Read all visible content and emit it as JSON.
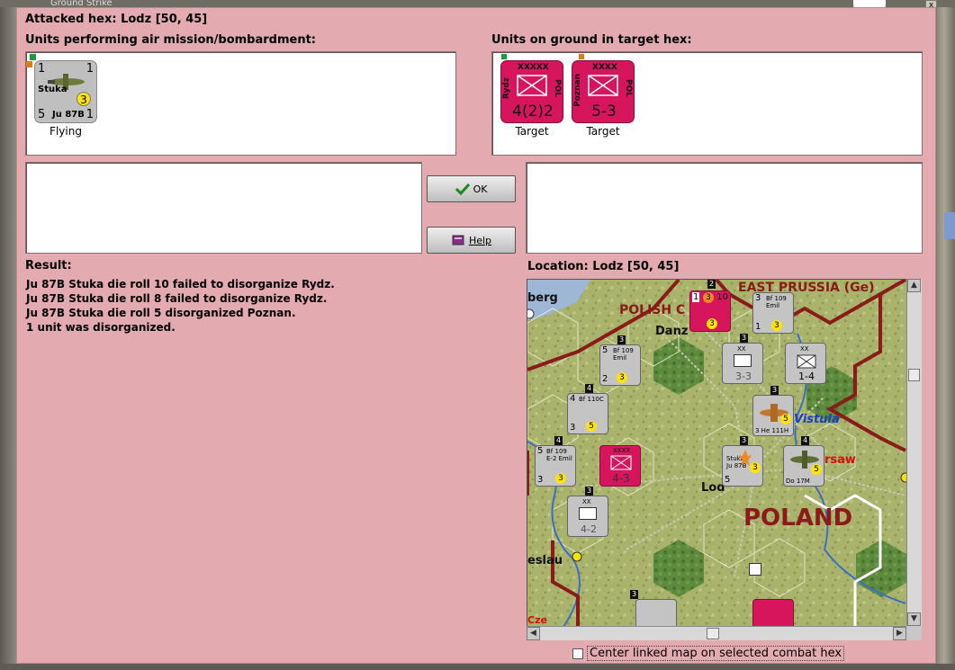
{
  "window": {
    "title": "Ground Strike",
    "close_glyph": "x"
  },
  "attacked_hex": "Attacked hex: Lodz  [50, 45]",
  "air_section": {
    "label": "Units performing air mission/bombardment:",
    "units": [
      {
        "name": "Stuka",
        "type": "Ju 87B",
        "top_left": "1",
        "top_right": "1",
        "bottom_left": "5",
        "bottom_right": "1",
        "badge": "3",
        "status": "Flying"
      }
    ]
  },
  "ground_section": {
    "label": "Units on ground in target hex:",
    "units": [
      {
        "name": "Rydz",
        "size": "XXXXX",
        "nation": "POL",
        "strength": "4(2)2",
        "status": "Target"
      },
      {
        "name": "Poznan",
        "size": "XXXX",
        "nation": "POL",
        "strength": "5-3",
        "status": "Target"
      }
    ]
  },
  "buttons": {
    "ok": "OK",
    "help": "Help"
  },
  "result": {
    "label": "Result:",
    "lines": [
      "Ju 87B Stuka die roll 10 failed to disorganize Rydz.",
      "Ju 87B Stuka die roll 8 failed to disorganize Rydz.",
      "Ju 87B Stuka die roll 5 disorganized Poznan.",
      "1 unit was disorganized."
    ]
  },
  "location": {
    "label": "Location:  Lodz  [50, 45]",
    "map_labels": {
      "east_prussia": "EAST PRUSSIA (Ge)",
      "polish_corridor": "POLISH C",
      "danzig": "Danz",
      "vistula": "Vistula",
      "warsaw": "rsaw",
      "lodz": "Lod",
      "poland": "POLAND",
      "breslau": "eslau",
      "konigsberg": "berg",
      "czech": "Cze"
    },
    "map_counters": [
      {
        "label": "Bf 109 Emil",
        "a": "5",
        "b": "2",
        "c": "3"
      },
      {
        "label": "Bf 109 Emil",
        "a": "3",
        "b": "1",
        "c": "3"
      },
      {
        "label": "Bf 110C",
        "a": "4",
        "b": "3",
        "c": "5"
      },
      {
        "label": "Bf 109 E-2 Emil",
        "a": "5",
        "b": "3",
        "c": "3"
      },
      {
        "label": "XX",
        "a": "3-3",
        "b": "",
        "c": ""
      },
      {
        "label": "XX",
        "a": "1-4",
        "b": "",
        "c": ""
      },
      {
        "label": "3 He 111H",
        "a": "3",
        "b": "1",
        "c": "5"
      },
      {
        "label": "XXXX",
        "a": "4-3",
        "b": "",
        "c": ""
      },
      {
        "label": "Stuka Ju 87B",
        "a": "5",
        "b": "1",
        "c": "3"
      },
      {
        "label": "Do 17M",
        "a": "2",
        "b": "2",
        "c": "5"
      },
      {
        "label": "XX",
        "a": "4-2",
        "b": "",
        "c": ""
      },
      {
        "label": "10",
        "a": "1",
        "b": "3",
        "c": "3"
      }
    ],
    "stack_numbers": [
      "2",
      "3",
      "4",
      "4",
      "3",
      "3",
      "3",
      "4",
      "3",
      "3"
    ]
  },
  "center_checkbox": {
    "label": "Center linked map on selected combat hex",
    "checked": false
  },
  "colors": {
    "dialog_bg": "#e3aab0",
    "polish_counter": "#d6155d",
    "german_air_counter": "#bfbfbf",
    "map_border": "#8b1a1a",
    "poland_text": "#8b1a1a"
  }
}
